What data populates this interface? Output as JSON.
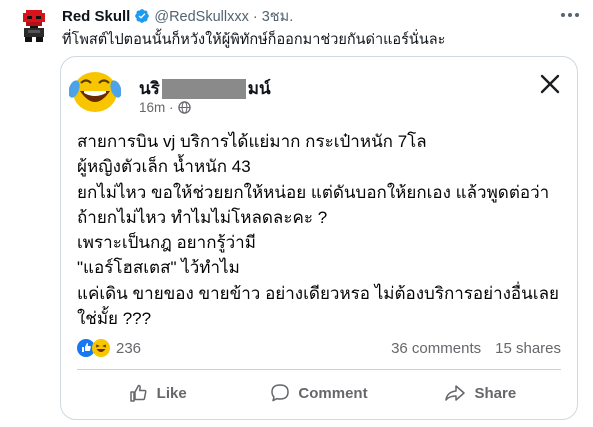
{
  "tweet": {
    "author_name": "Red Skull",
    "handle_time": "@RedSkullxxx · 3ชม.",
    "text": "ที่โพสต์ไปตอนนั้นก็หวังให้ผู้พิทักษ์ก็ออกมาช่วยกันด่าแอร์นั่นละ",
    "icons": {
      "avatar": "pixel-skull-avatar",
      "verified": "verified-badge-icon",
      "more": "more-options-icon"
    },
    "colors": {
      "verified": "#1d9bf0",
      "secondary_text": "#536471"
    }
  },
  "post": {
    "poster_name_start": "นริ",
    "poster_name_end": "มน์",
    "time": "16m ·",
    "body_lines": [
      "สายการบิน vj บริการได้แย่มาก กระเป๋าหนัก 7โล",
      "ผู้หญิงตัวเล็ก น้ำหนัก 43",
      "ยกไม่ไหว ขอให้ช่วยยกให้หน่อย แต่ดันบอกให้ยกเอง แล้วพูดต่อว่า",
      "ถ้ายกไม่ไหว ทำไมไม่โหลดละคะ ?",
      "เพราะเป็นกฎ อยากรู้ว่ามี",
      "\"แอร์โฮสเตส\" ไว้ทำไม",
      "แค่เดิน ขายของ ขายข้าว อย่างเดียวหรอ ไม่ต้องบริการอย่างอื่นเลย",
      "ใช่มั้ย ???"
    ],
    "reaction_count": "236",
    "comments": "36 comments",
    "shares": "15 shares",
    "actions": {
      "like": "Like",
      "comment": "Comment",
      "share": "Share"
    },
    "icons": [
      "laughing-crying-emoji",
      "globe-icon",
      "close-icon",
      "like-reaction-icon",
      "haha-reaction-icon",
      "thumbs-up-icon",
      "comment-icon",
      "share-icon"
    ]
  }
}
